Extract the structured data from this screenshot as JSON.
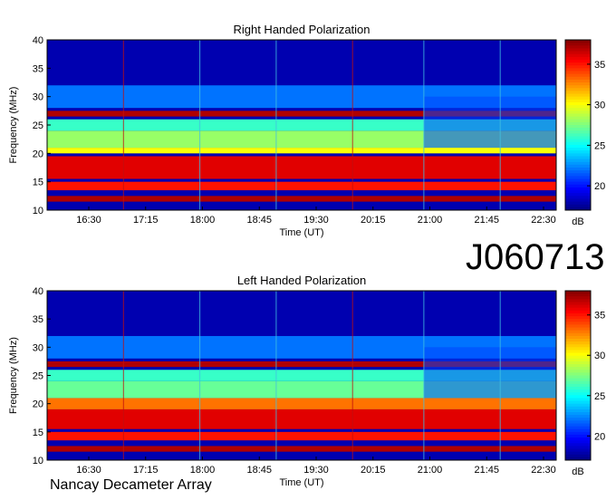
{
  "observation_id": "J060713",
  "instrument": "Nancay Decameter Array",
  "colors": {
    "background_blue": "#1040c8",
    "band_red": "#a00000",
    "band_yellow": "#f0e020",
    "band_cyan": "#40d0e0",
    "frame": "#000000"
  },
  "chart_data": [
    {
      "type": "heatmap",
      "title": "Right Handed Polarization",
      "xlabel": "Time (UT)",
      "ylabel": "Frequency (MHz)",
      "x_ticks": [
        "16:30",
        "17:15",
        "18:00",
        "18:45",
        "19:30",
        "20:15",
        "21:00",
        "21:45",
        "22:30"
      ],
      "y_ticks": [
        "10",
        "15",
        "20",
        "25",
        "30",
        "35",
        "40"
      ],
      "ylim": [
        10,
        40
      ],
      "colorbar": {
        "label": "dB",
        "ticks": [
          "20",
          "25",
          "30",
          "35"
        ],
        "range": [
          17,
          38
        ]
      },
      "bands": [
        {
          "freq": [
            11.5,
            12.5
          ],
          "db": 37
        },
        {
          "freq": [
            13.5,
            15.0
          ],
          "db": 35
        },
        {
          "freq": [
            15.5,
            19.5
          ],
          "db": 36
        },
        {
          "freq": [
            20.0,
            21.0
          ],
          "db": 30
        },
        {
          "freq": [
            21.0,
            24.0
          ],
          "db": 28
        },
        {
          "freq": [
            24.0,
            26.0
          ],
          "db": 26
        },
        {
          "freq": [
            26.5,
            27.5
          ],
          "db": 37
        },
        {
          "freq": [
            28.0,
            32.0
          ],
          "db": 22
        },
        {
          "freq": [
            32.0,
            40.0
          ],
          "db": 18
        }
      ]
    },
    {
      "type": "heatmap",
      "title": "Left Handed Polarization",
      "xlabel": "Time (UT)",
      "ylabel": "Frequency (MHz)",
      "x_ticks": [
        "16:30",
        "17:15",
        "18:00",
        "18:45",
        "19:30",
        "20:15",
        "21:00",
        "21:45",
        "22:30"
      ],
      "y_ticks": [
        "10",
        "15",
        "20",
        "25",
        "30",
        "35",
        "40"
      ],
      "ylim": [
        10,
        40
      ],
      "colorbar": {
        "label": "dB",
        "ticks": [
          "20",
          "25",
          "30",
          "35"
        ],
        "range": [
          17,
          38
        ]
      },
      "bands": [
        {
          "freq": [
            11.5,
            12.5
          ],
          "db": 37
        },
        {
          "freq": [
            13.5,
            15.0
          ],
          "db": 35
        },
        {
          "freq": [
            15.5,
            19.0
          ],
          "db": 36
        },
        {
          "freq": [
            19.0,
            21.0
          ],
          "db": 33
        },
        {
          "freq": [
            21.0,
            24.0
          ],
          "db": 27
        },
        {
          "freq": [
            24.0,
            26.0
          ],
          "db": 26
        },
        {
          "freq": [
            26.5,
            27.5
          ],
          "db": 37
        },
        {
          "freq": [
            28.0,
            32.0
          ],
          "db": 22
        },
        {
          "freq": [
            32.0,
            40.0
          ],
          "db": 18
        }
      ]
    }
  ]
}
